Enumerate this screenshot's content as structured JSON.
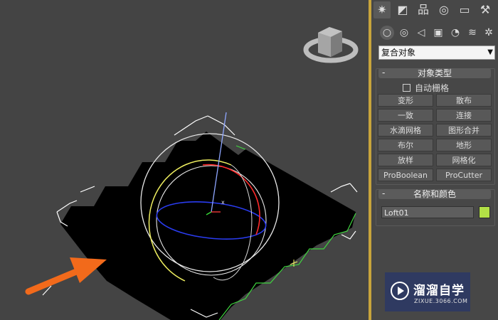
{
  "command_panel": {
    "tabs": [
      {
        "icon": "create-icon",
        "glyph": "✷",
        "active": true
      },
      {
        "icon": "modify-icon",
        "glyph": "◩",
        "active": false
      },
      {
        "icon": "hierarchy-icon",
        "glyph": "品",
        "active": false
      },
      {
        "icon": "motion-icon",
        "glyph": "◎",
        "active": false
      },
      {
        "icon": "display-icon",
        "glyph": "▭",
        "active": false
      },
      {
        "icon": "utilities-icon",
        "glyph": "⚒",
        "active": false
      }
    ],
    "subtabs": [
      {
        "icon": "geometry-icon",
        "glyph": "○",
        "active": true
      },
      {
        "icon": "shapes-icon",
        "glyph": "◎",
        "active": false
      },
      {
        "icon": "lights-icon",
        "glyph": "◁",
        "active": false
      },
      {
        "icon": "cameras-icon",
        "glyph": "▣",
        "active": false
      },
      {
        "icon": "helpers-icon",
        "glyph": "◔",
        "active": false
      },
      {
        "icon": "space-warps-icon",
        "glyph": "≋",
        "active": false
      },
      {
        "icon": "systems-icon",
        "glyph": "✲",
        "active": false
      }
    ],
    "category_dropdown": {
      "value": "复合对象"
    }
  },
  "object_type": {
    "title": "对象类型",
    "collapse": "-",
    "autogrid_label": "自动栅格",
    "buttons": [
      "变形",
      "散布",
      "一致",
      "连接",
      "水滴网格",
      "图形合并",
      "布尔",
      "地形",
      "放样",
      "网格化",
      "ProBoolean",
      "ProCutter"
    ]
  },
  "name_color": {
    "title": "名称和颜色",
    "collapse": "-",
    "name_value": "Loft01",
    "color": "#b2e046"
  },
  "watermark": {
    "title": "溜溜自学",
    "url": "ZIXUE.3066.COM"
  },
  "colors": {
    "viewport_bg": "#444444",
    "viewport_border": "#c8a43c",
    "selection": "#ffffff",
    "arrow": "#f26a1b"
  }
}
